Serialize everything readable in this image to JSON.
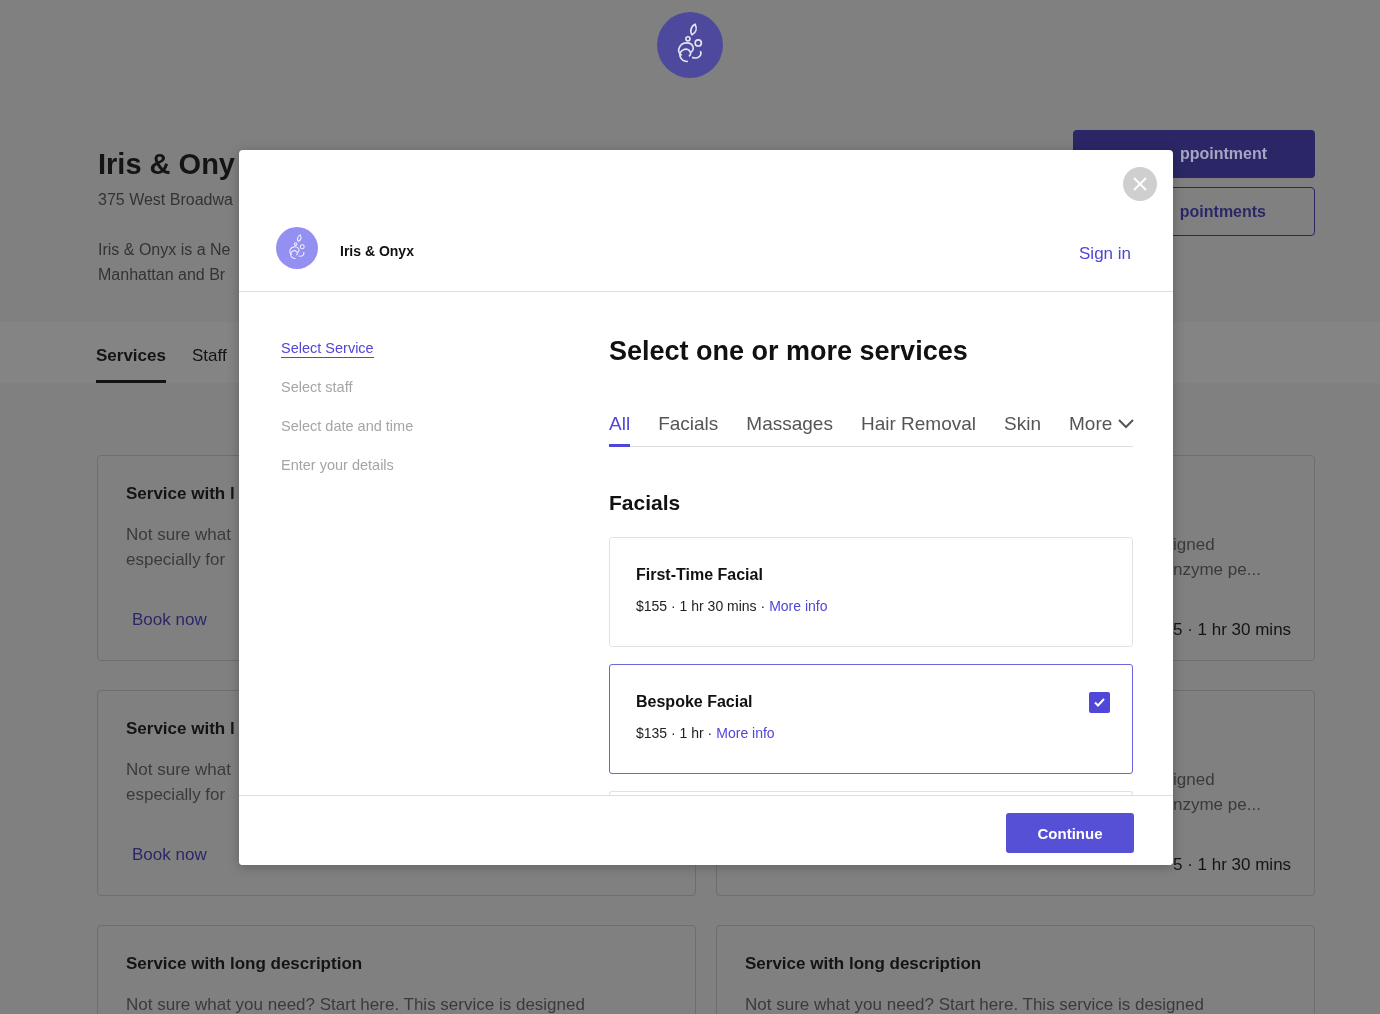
{
  "page": {
    "business_name": "Iris & Ony",
    "address": "375 West Broadwa",
    "description": [
      "Iris & Onyx is a Ne",
      "Manhattan and Br"
    ],
    "buttons": [
      {
        "label": "ppointment",
        "kind": "primary"
      },
      {
        "label": "pointments",
        "kind": "outline"
      }
    ],
    "tabs": [
      {
        "label": "Services",
        "selected": true
      },
      {
        "label": "Staff",
        "selected": false
      }
    ],
    "service_cards": [
      {
        "kind": "clipped_left",
        "title": "Service with l",
        "description": [
          "Not sure what",
          "especially for"
        ],
        "link": "Book now"
      },
      {
        "kind": "clipped_right",
        "description": [
          "igned",
          "nzyme pe..."
        ],
        "meta": "5 · 1 hr 30 mins"
      },
      {
        "kind": "clipped_left",
        "title": "Service with l",
        "description": [
          "Not sure what",
          "especially for"
        ],
        "link": "Book now"
      },
      {
        "kind": "clipped_right",
        "description": [
          "igned",
          "nzyme pe..."
        ],
        "meta": "5 · 1 hr 30 mins"
      },
      {
        "kind": "full",
        "title": "Service with long description",
        "description": [
          "Not sure what you need? Start here. This service is designed"
        ]
      },
      {
        "kind": "full",
        "title": "Service with long description",
        "description": [
          "Not sure what you need? Start here. This service is designed"
        ]
      }
    ]
  },
  "modal": {
    "business_name": "Iris & Onyx",
    "sign_in": "Sign in",
    "steps": [
      {
        "label": "Select Service",
        "selected": true
      },
      {
        "label": "Select staff",
        "selected": false
      },
      {
        "label": "Select date and time",
        "selected": false
      },
      {
        "label": "Enter your details",
        "selected": false
      }
    ],
    "heading": "Select one or more services",
    "categories": [
      {
        "label": "All",
        "selected": true,
        "kind": "tab"
      },
      {
        "label": "Facials",
        "selected": false,
        "kind": "tab"
      },
      {
        "label": "Massages",
        "selected": false,
        "kind": "tab"
      },
      {
        "label": "Hair Removal",
        "selected": false,
        "kind": "tab"
      },
      {
        "label": "Skin",
        "selected": false,
        "kind": "tab"
      },
      {
        "label": "More",
        "selected": false,
        "kind": "dropdown"
      }
    ],
    "section_title": "Facials",
    "services": [
      {
        "name": "First-Time Facial",
        "details": "$155 · 1 hr 30 mins ·",
        "link": "More info",
        "checked": false
      },
      {
        "name": "Bespoke Facial",
        "details": "$135 · 1 hr ·",
        "link": "More info",
        "checked": true
      }
    ],
    "continue": "Continue"
  }
}
